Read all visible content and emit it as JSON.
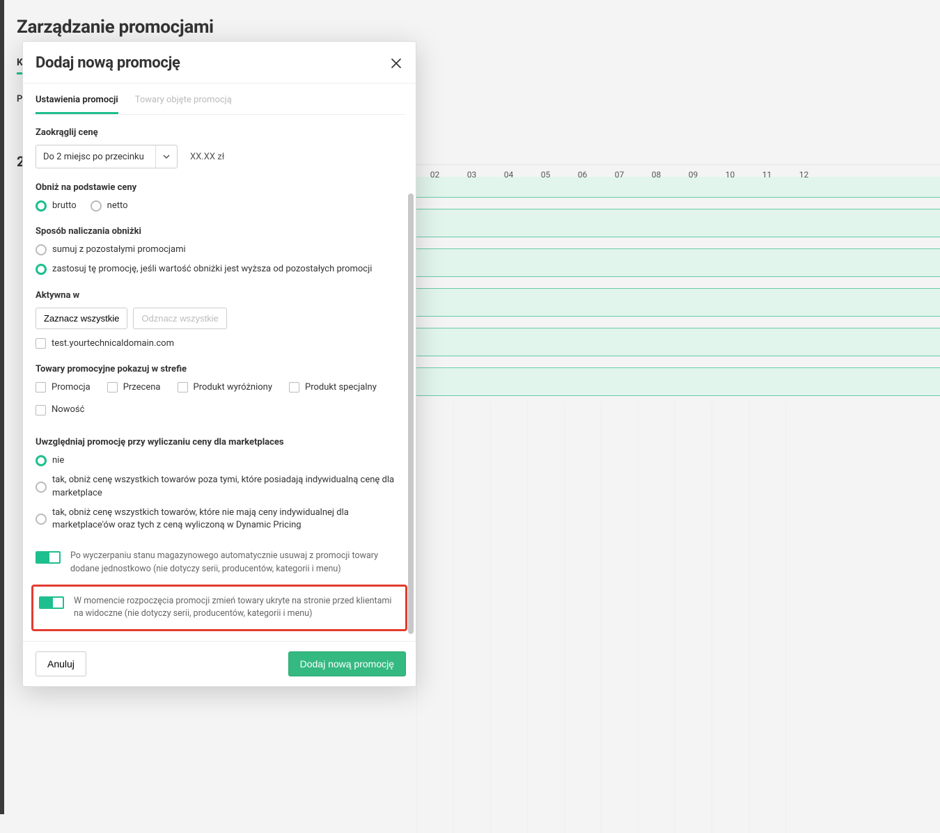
{
  "page": {
    "title": "Zarządzanie promocjami",
    "tab_calendar_first_letter": "K",
    "filter_label_first_letter": "P",
    "year": "2"
  },
  "modal": {
    "title": "Dodaj nową promocję",
    "tabs": {
      "settings": "Ustawienia promocji",
      "products": "Towary objęte promocją"
    },
    "rounding": {
      "label": "Zaokrąglij cenę",
      "select_value": "Do 2 miejsc po przecinku",
      "sample": "XX.XX zł"
    },
    "price_basis": {
      "label": "Obniż na podstawie ceny",
      "brutto": "brutto",
      "netto": "netto"
    },
    "calc_method": {
      "label": "Sposób naliczania obniżki",
      "sum": "sumuj z pozostałymi promocjami",
      "higher": "zastosuj tę promocję, jeśli wartość obniżki jest wyższa od pozostałych promocji"
    },
    "active_in": {
      "label": "Aktywna w",
      "select_all": "Zaznacz wszystkie",
      "deselect_all": "Odznacz wszystkie",
      "domain": "test.yourtechnicaldomain.com"
    },
    "zones": {
      "label": "Towary promocyjne pokazuj w strefie",
      "promo": "Promocja",
      "markdown": "Przecena",
      "featured": "Produkt wyróżniony",
      "special": "Produkt specjalny",
      "novelty": "Nowość"
    },
    "marketplaces": {
      "label": "Uwzględniaj promocję przy wyliczaniu ceny dla marketplaces",
      "no": "nie",
      "yes1": "tak, obniż cenę wszystkich towarów poza tymi, które posiadają indywidualną cenę dla marketplace",
      "yes2": "tak, obniż cenę wszystkich towarów, które nie mają ceny indywidualnej dla marketplace'ów oraz tych z ceną wyliczoną w Dynamic Pricing"
    },
    "toggle1": "Po wyczerpaniu stanu magazynowego automatycznie usuwaj z promocji towary dodane jednostkowo (nie dotyczy serii, producentów, kategorii i menu)",
    "toggle2": "W momencie rozpoczęcia promocji zmień towary ukryte na stronie przed klientami na widoczne (nie dotyczy serii, producentów, kategorii i menu)",
    "cancel": "Anuluj",
    "submit": "Dodaj nową promocję"
  },
  "timeline": {
    "days": [
      "02",
      "03",
      "04",
      "05",
      "06",
      "07",
      "08",
      "09",
      "10",
      "11",
      "12"
    ]
  }
}
